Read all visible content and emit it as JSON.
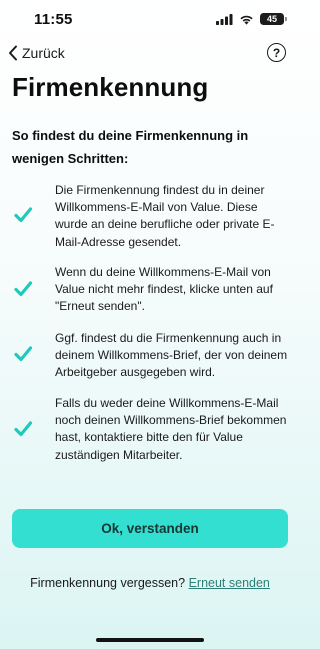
{
  "status_bar": {
    "time": "11:55",
    "battery_level": "45",
    "icons": [
      "signal-icon",
      "wifi-icon",
      "battery-icon"
    ]
  },
  "nav": {
    "back_label": "Zurück",
    "help_label": "?"
  },
  "page": {
    "title": "Firmenkennung",
    "intro": "So findest du deine Firmenkennung in wenigen Schritten:"
  },
  "steps": [
    {
      "text": "Die Firmenkennung findest du in deiner Willkommens-E-Mail von Value. Diese wurde an deine berufliche oder private E-Mail-Adresse gesendet."
    },
    {
      "text": "Wenn du deine Willkommens-E-Mail von Value nicht mehr findest, klicke unten auf \"Erneut senden\"."
    },
    {
      "text": "Ggf. findest du die Firmenkennung auch in deinem Willkommens-Brief, der von deinem Arbeitgeber ausgegeben wird."
    },
    {
      "text": "Falls du weder deine Willkommens-E-Mail noch deinen Willkommens-Brief bekommen hast, kontaktiere bitte den für Value zuständigen Mitarbeiter."
    }
  ],
  "cta": {
    "label": "Ok, verstanden"
  },
  "footer": {
    "prompt": "Firmenkennung vergessen?",
    "link_label": "Erneut senden"
  },
  "colors": {
    "accent": "#33dfd1",
    "check": "#1fc9bb",
    "link": "#2d7f76"
  }
}
